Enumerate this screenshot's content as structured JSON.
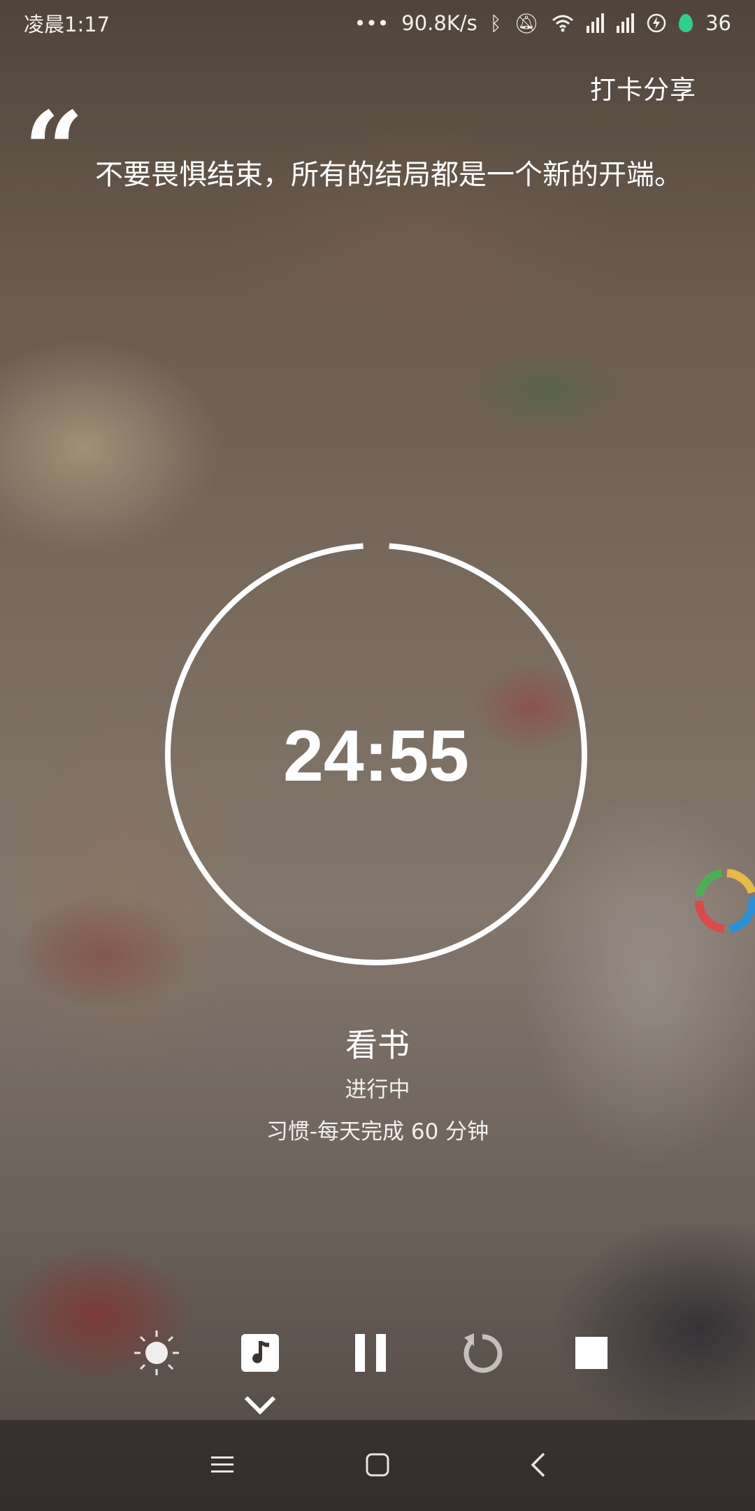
{
  "status_bar": {
    "time": "凌晨1:17",
    "network_speed": "90.8K/s",
    "battery_level": "36",
    "icons": [
      "dots-icon",
      "bluetooth-icon",
      "mute-icon",
      "wifi-icon",
      "signal-icon",
      "signal-icon",
      "charging-icon",
      "battery-drop-icon"
    ]
  },
  "header": {
    "share_label": "打卡分享"
  },
  "quote": {
    "mark": "“",
    "text": "不要畏惧结束，所有的结局都是一个新的开端。"
  },
  "timer": {
    "time": "24:55",
    "progress_fraction": 0.98
  },
  "task": {
    "name": "看书",
    "status": "进行中",
    "habit": "习惯-每天完成 60  分钟"
  },
  "controls": {
    "items": [
      "brightness-icon",
      "music-icon",
      "pause-icon",
      "reset-icon",
      "stop-icon"
    ]
  },
  "nav_bar": {
    "items": [
      "menu-icon",
      "home-icon",
      "back-icon"
    ]
  },
  "colors": {
    "accent_drop": "#2ecf8a",
    "ring": "#ffffff"
  }
}
